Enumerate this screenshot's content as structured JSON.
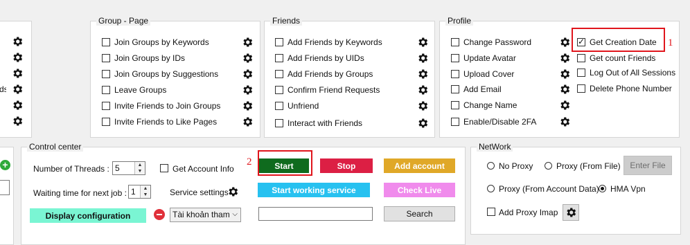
{
  "left_partial": {
    "label": "ds"
  },
  "group_page": {
    "title": "Group - Page",
    "items": [
      "Join Groups by Keywords",
      "Join Groups by IDs",
      "Join Groups by Suggestions",
      "Leave Groups",
      "Invite Friends to Join Groups",
      "Invite Friends to Like Pages"
    ]
  },
  "friends": {
    "title": "Friends",
    "items": [
      "Add Friends by Keywords",
      "Add Friends by UIDs",
      "Add Friends by  Groups",
      "Confirm Friend Requests",
      "Unfriend",
      "Interact with Friends"
    ]
  },
  "profile": {
    "title": "Profile",
    "items": [
      "Change Password",
      "Update Avatar",
      "Upload Cover",
      "Add Email",
      "Change Name",
      "Enable/Disable 2FA"
    ],
    "extra_items": [
      {
        "label": "Get Creation Date",
        "checked": true
      },
      {
        "label": "Get count Friends",
        "checked": false
      },
      {
        "label": "Log Out of All Sessions",
        "checked": false
      },
      {
        "label": "Delete Phone Number",
        "checked": false
      }
    ]
  },
  "control_center": {
    "title": "Control center",
    "threads_label": "Number of Threads :",
    "threads_value": "5",
    "wait_label": "Waiting time for next job :",
    "wait_value": "1",
    "get_account_info_label": "Get Account Info",
    "service_settings_label": "Service settings",
    "display_configuration_label": "Display configuration",
    "account_select_value": "Tài khoản tham g",
    "start_label": "Start",
    "stop_label": "Stop",
    "add_account_label": "Add account",
    "start_service_label": "Start working service",
    "check_live_label": "Check Live",
    "search_input_value": "",
    "search_label": "Search"
  },
  "network": {
    "title": "NetWork",
    "no_proxy_label": "No Proxy",
    "proxy_file_label": "Proxy (From File)",
    "enter_file_label": "Enter File",
    "proxy_account_label": "Proxy (From Account Data)",
    "hma_label": "HMA Vpn",
    "selected": "HMA Vpn",
    "add_proxy_imap_label": "Add Proxy Imap"
  },
  "annotations": {
    "one": "1",
    "two": "2"
  },
  "colors": {
    "start": "#0f6b1e",
    "stop": "#dc1f44",
    "add_account": "#e0a828",
    "start_service": "#27c1f0",
    "check_live": "#f08bec",
    "display_configuration": "#7af5d3",
    "annotation_red": "#e0151c"
  }
}
